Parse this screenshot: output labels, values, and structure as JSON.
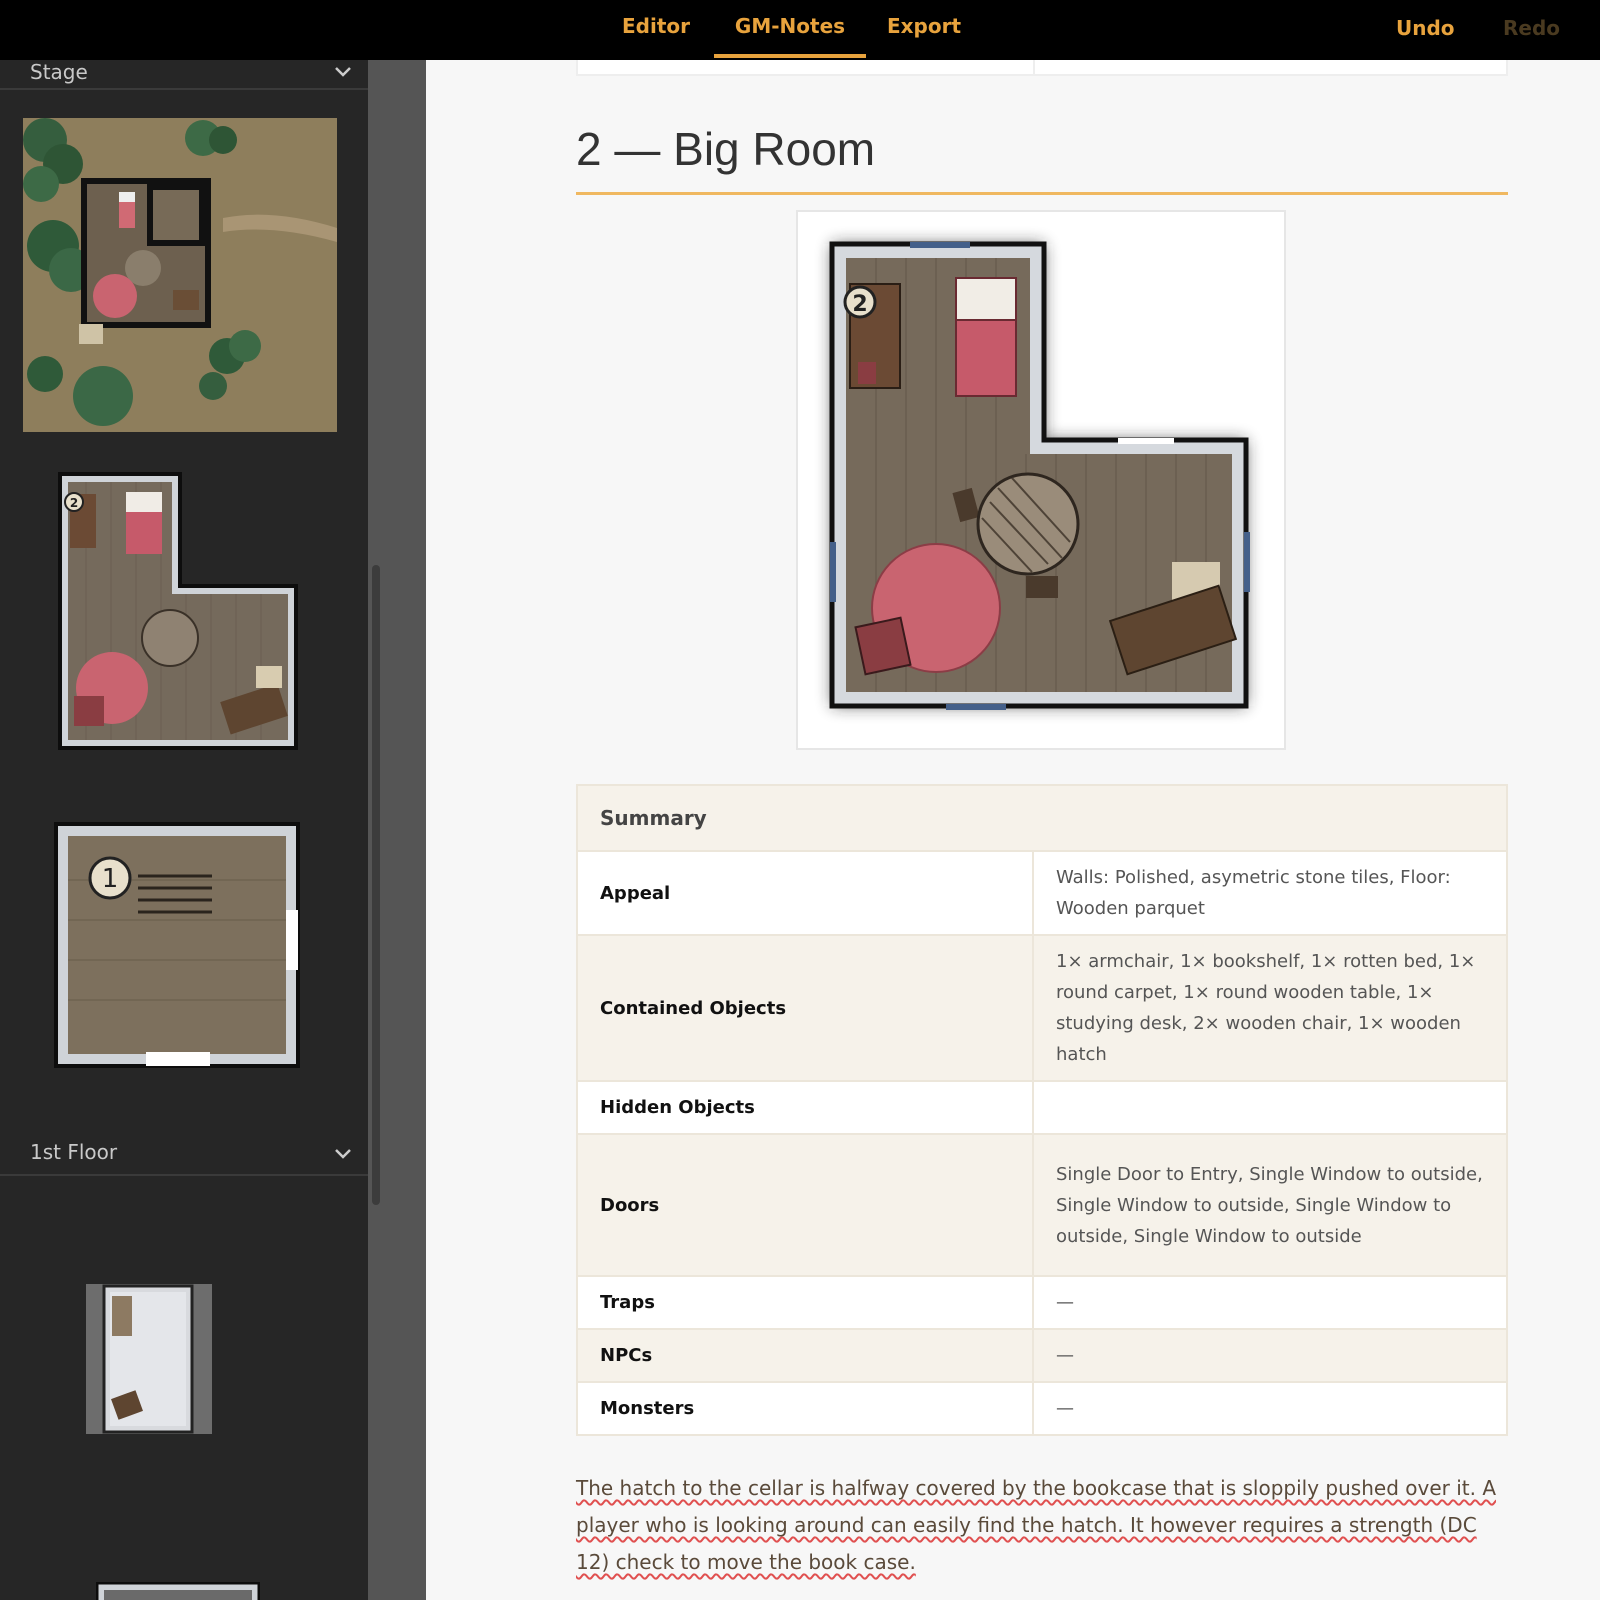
{
  "topbar": {
    "tabs": [
      {
        "label": "Editor"
      },
      {
        "label": "GM-Notes",
        "active": true
      },
      {
        "label": "Export"
      }
    ],
    "undo_label": "Undo",
    "redo_label": "Redo",
    "accent": "#e8a33d"
  },
  "sidebar": {
    "sections": [
      {
        "label": "Stage"
      },
      {
        "label": "1st Floor"
      }
    ]
  },
  "room": {
    "title": "2 — Big Room",
    "marker": "2",
    "summary": {
      "header": "Summary",
      "rows": [
        {
          "key": "Appeal",
          "value": "Walls: Polished, asymetric stone tiles, Floor: Wooden parquet"
        },
        {
          "key": "Contained Objects",
          "value": "1× armchair, 1× bookshelf, 1× rotten bed, 1× round carpet, 1× round wooden table, 1× studying desk, 2× wooden chair, 1× wooden hatch"
        },
        {
          "key": "Hidden Objects",
          "value": ""
        },
        {
          "key": "Doors",
          "value": "Single Door to Entry, Single Window to outside, Single Window to outside, Single Window to outside, Single Window to outside"
        },
        {
          "key": "Traps",
          "value": "—"
        },
        {
          "key": "NPCs",
          "value": "—"
        },
        {
          "key": "Monsters",
          "value": "—"
        }
      ]
    },
    "note": "The hatch to the cellar is halfway covered by the bookcase that is sloppily pushed over it. A player who is looking around can easily find the hatch. It however requires a strength (DC 12) check to move the book case."
  },
  "thumbnails": [
    {
      "name": "stage-map-thumbnail"
    },
    {
      "name": "room-2-thumbnail",
      "marker": "2"
    },
    {
      "name": "room-1-thumbnail",
      "marker": "1"
    },
    {
      "name": "1st-floor-room-thumbnail"
    }
  ]
}
